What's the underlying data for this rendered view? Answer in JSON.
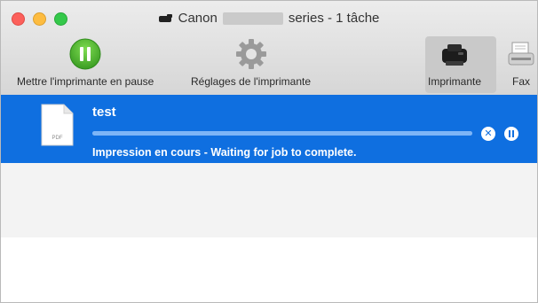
{
  "window": {
    "title_prefix": "Canon",
    "title_suffix": "series - 1 tâche"
  },
  "toolbar": {
    "pause_label": "Mettre l'imprimante en pause",
    "settings_label": "Réglages de l'imprimante",
    "printer_label": "Imprimante",
    "fax_label": "Fax"
  },
  "job": {
    "name": "test",
    "file_type": "PDF",
    "status": "Impression en cours - Waiting for job to complete.",
    "progress_fraction": 1.0
  },
  "colors": {
    "selection": "#0f6fe0",
    "pause_green": "#43b02a"
  }
}
